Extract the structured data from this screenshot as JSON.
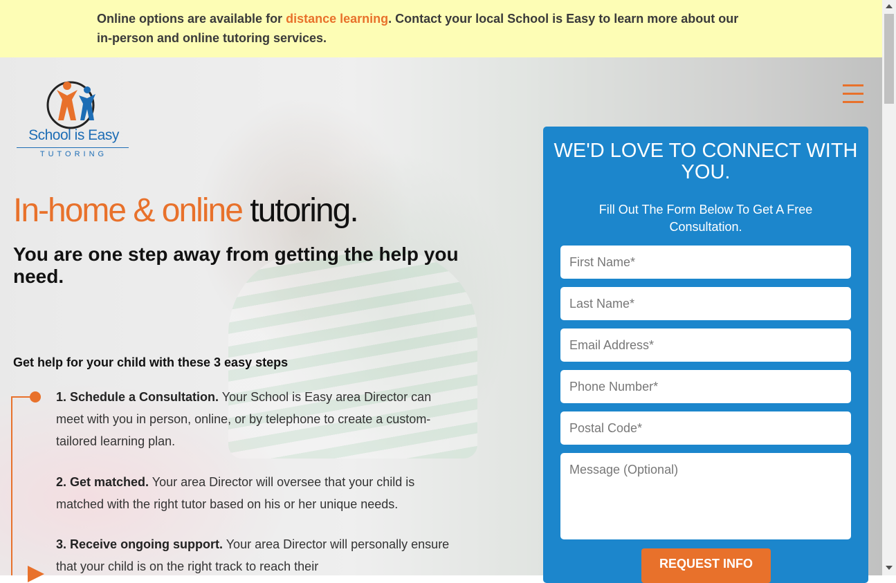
{
  "banner": {
    "text_before": "Online options are available for ",
    "link": "distance learning",
    "text_after": ". Contact your local School is Easy to learn more about our in-person and online tutoring services."
  },
  "logo": {
    "name": "School is Easy",
    "sub": "TUTORING"
  },
  "menu": {
    "icon": "hamburger-menu-icon"
  },
  "hero": {
    "title_orange": "In-home & online",
    "title_dark": " tutoring.",
    "subtitle": "You are one step away from getting the help you need."
  },
  "steps": {
    "title": "Get help for your child with these 3 easy steps",
    "items": [
      {
        "bold": "1. Schedule a Consultation.",
        "text": " Your School is Easy area Director can meet with you in person, online, or by telephone to create a custom-tailored learning plan."
      },
      {
        "bold": "2. Get matched.",
        "text": " Your area Director will oversee that your child is matched with the right tutor based on his or her unique needs."
      },
      {
        "bold": "3. Receive ongoing support.",
        "text": " Your area Director will personally ensure that your child is on the right track to reach their"
      }
    ]
  },
  "form": {
    "title": "WE'D LOVE TO CONNECT WITH YOU.",
    "subtitle": "Fill Out The Form Below To Get A Free Consultation.",
    "first_name": "First Name*",
    "last_name": "Last Name*",
    "email": "Email Address*",
    "phone": "Phone Number*",
    "postal": "Postal Code*",
    "message": "Message (Optional)",
    "submit": "REQUEST INFO"
  },
  "colors": {
    "accent": "#e8712b",
    "form_bg": "#1c86cc",
    "banner_bg": "#fdfdb5",
    "logo_blue": "#1d6db5"
  }
}
